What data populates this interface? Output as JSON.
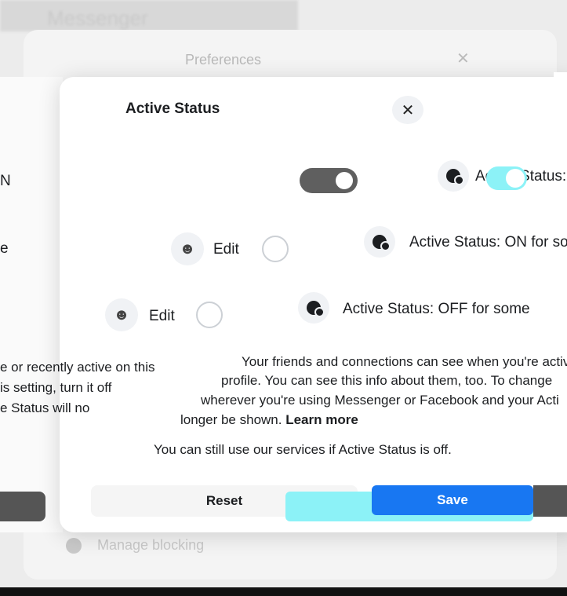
{
  "background": {
    "top_title": "Messenger",
    "preferences_title": "Preferences",
    "close_glyph": "✕",
    "manage_blocking": "Manage blocking"
  },
  "dialog": {
    "title": "Active Status",
    "close_glyph": "✕"
  },
  "rows": {
    "on": {
      "label": "Active Status: ON",
      "left_fragment": "N",
      "toggle_on": true
    },
    "on_some": {
      "label": "Active Status: ON for some",
      "left_fragment": "e",
      "edit_label": "Edit"
    },
    "off_some": {
      "label": "Active Status: OFF for some",
      "edit_label": "Edit"
    }
  },
  "description": {
    "left_lines": [
      "e or recently active on this",
      "is setting, turn it off",
      "e Status will no"
    ],
    "right_lines": [
      "Your friends and connections can see when you're active",
      "profile. You can see this info about them, too. To change",
      "wherever you're using Messenger or Facebook and your Acti"
    ],
    "last_line": "longer be shown.",
    "learn_more": "Learn more",
    "note": "You can still use our services if Active Status is off."
  },
  "buttons": {
    "reset": "Reset",
    "save_ghost": "Save",
    "save": "Save"
  },
  "colors": {
    "accent": "#1877f2",
    "toggle_on": "#8cf2f7"
  }
}
